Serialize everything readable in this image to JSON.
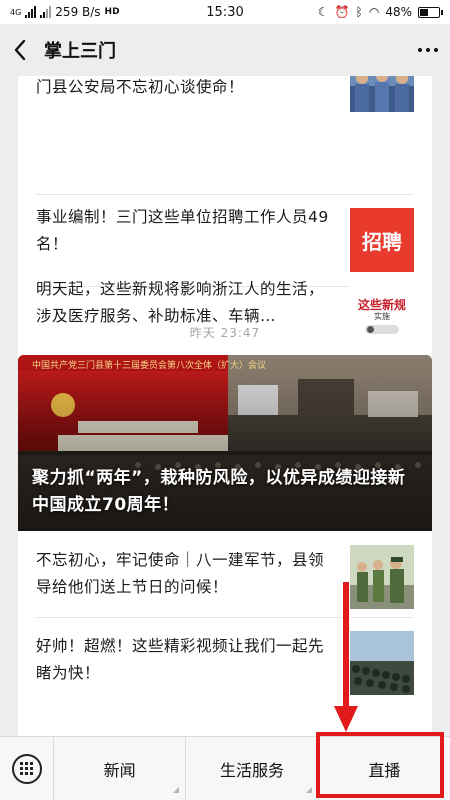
{
  "status_bar": {
    "network": "4G",
    "speed": "259 B/s",
    "hd": "HD",
    "time": "15:30",
    "battery": "48%",
    "battery_level": 0.48
  },
  "nav": {
    "title": "掌上三门"
  },
  "articles_top": [
    {
      "title": "门县公安局不忘初心谈使命！",
      "thumb_icon": "police-officers-photo"
    },
    {
      "title": "事业编制！三门这些单位招聘工作人员49名！",
      "thumb_icon": "recruitment-graphic",
      "thumb_text": "招聘"
    },
    {
      "title": "明天起，这些新规将影响浙江人的生活，涉及医疗服务、补助标准、车辆…",
      "thumb_icon": "new-rules-graphic",
      "thumb_text": "这些新规",
      "thumb_subtext": "实施"
    }
  ],
  "time_label": "昨天 23:47",
  "hero": {
    "title": "聚力抓“两年”，栽种防风险，以优异成绩迎接新中国成立70周年！",
    "banner_text": "中国共产党三门县第十三届委员会第八次全体（扩大）会议"
  },
  "articles_bottom": [
    {
      "title": "不忘初心，牢记使命｜八一建军节，县领导给他们送上节日的问候！",
      "thumb_icon": "soldiers-photo"
    },
    {
      "title": "好帅！超燃！这些精彩视频让我们一起先睹为快！",
      "thumb_icon": "parade-photo"
    }
  ],
  "menu": {
    "items": [
      "新闻",
      "生活服务",
      "直播"
    ]
  },
  "colors": {
    "annotation_red": "#e11b1b",
    "recruit_red": "#e83a2d",
    "banner_red": "#c81818"
  }
}
